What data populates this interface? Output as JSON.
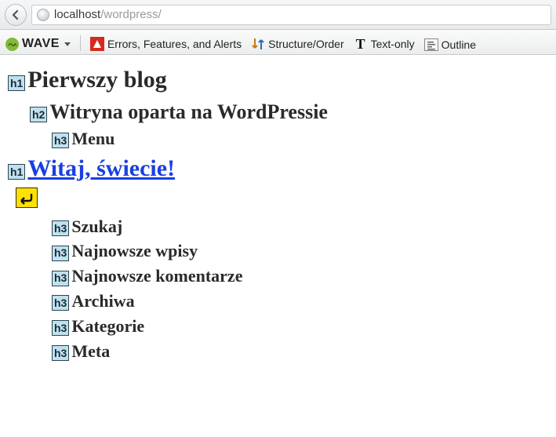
{
  "browser": {
    "url_host": "localhost",
    "url_path": "/wordpress/"
  },
  "toolbar": {
    "wave_label": "WAVE",
    "items": {
      "errors": "Errors, Features, and Alerts",
      "structure": "Structure/Order",
      "textonly": "Text-only",
      "outline": "Outline"
    }
  },
  "outline": [
    {
      "level": "h1",
      "text": "Pierwszy blog",
      "is_link": false
    },
    {
      "level": "h2",
      "text": "Witryna oparta na WordPressie",
      "is_link": false
    },
    {
      "level": "h3",
      "text": "Menu",
      "is_link": false
    },
    {
      "level": "h1",
      "text": "Witaj, świecie!",
      "is_link": true
    },
    {
      "level": "h3",
      "text": "Szukaj",
      "is_link": false
    },
    {
      "level": "h3",
      "text": "Najnowsze wpisy",
      "is_link": false
    },
    {
      "level": "h3",
      "text": "Najnowsze komentarze",
      "is_link": false
    },
    {
      "level": "h3",
      "text": "Archiwa",
      "is_link": false
    },
    {
      "level": "h3",
      "text": "Kategorie",
      "is_link": false
    },
    {
      "level": "h3",
      "text": "Meta",
      "is_link": false
    }
  ]
}
